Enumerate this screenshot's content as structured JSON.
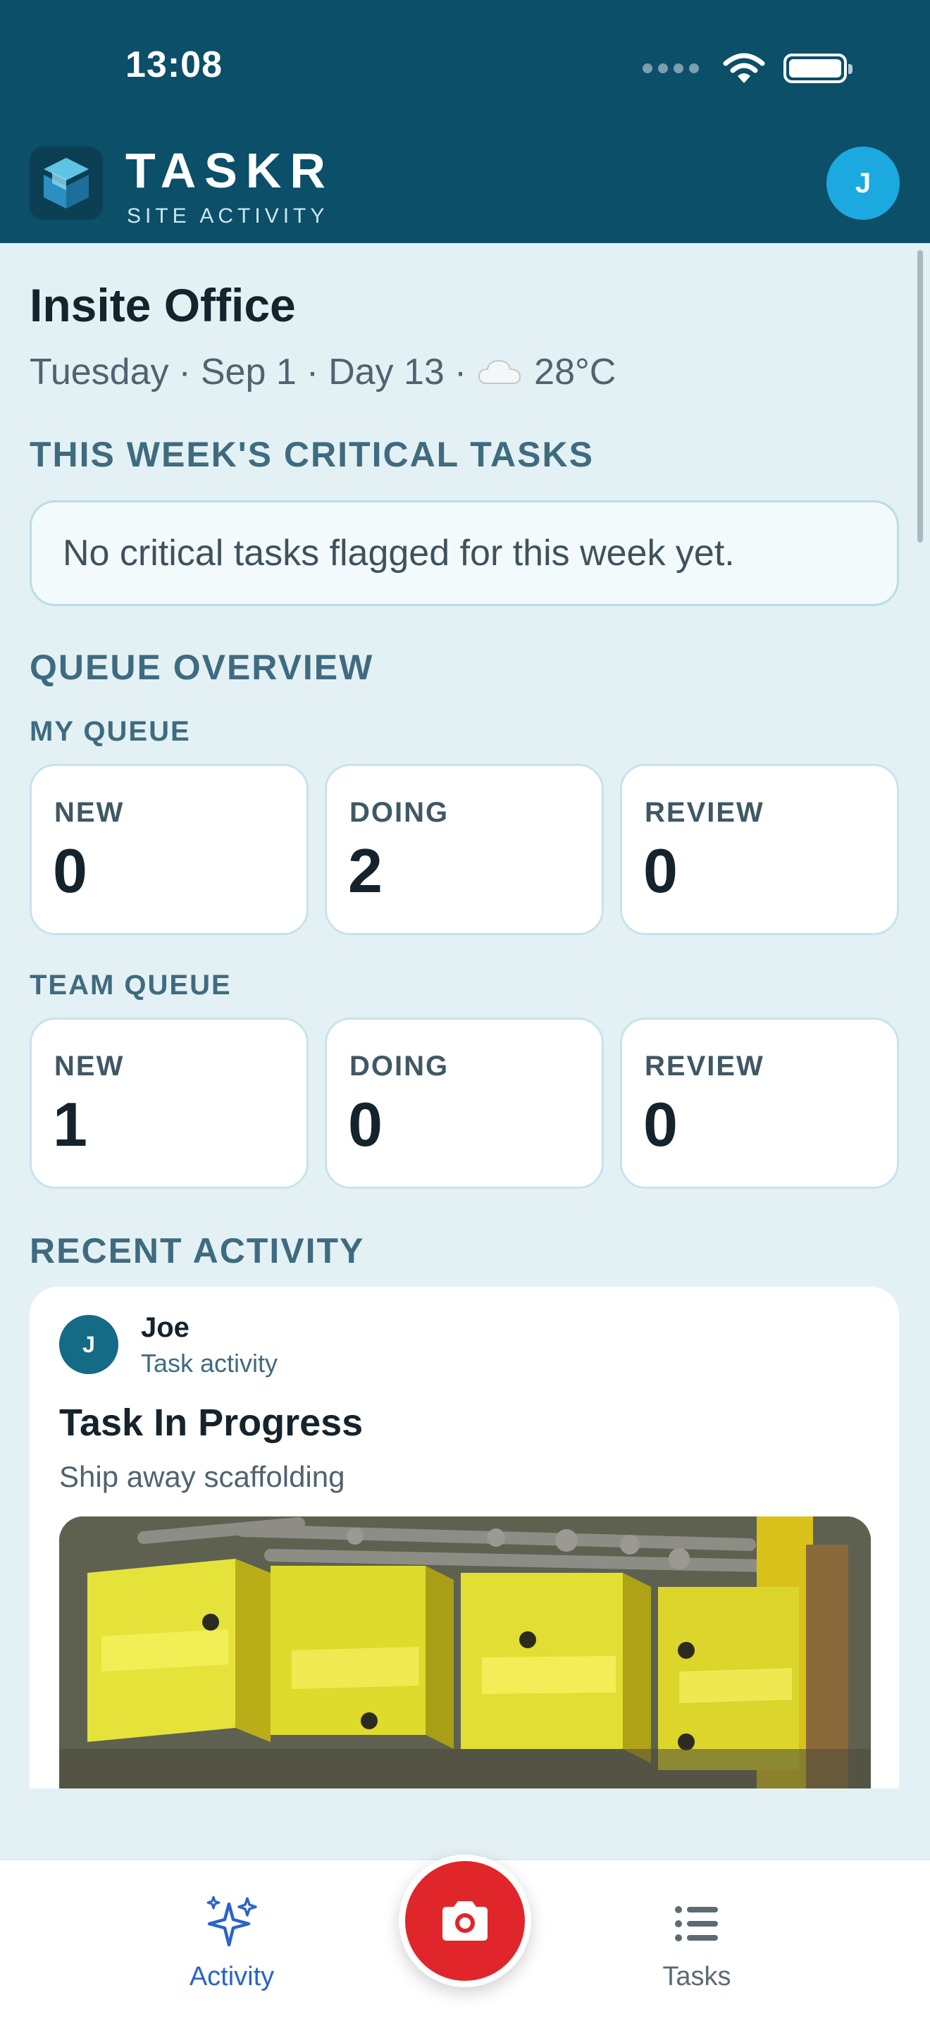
{
  "status_bar": {
    "time": "13:08"
  },
  "header": {
    "brand": "TASKR",
    "subtitle": "SITE ACTIVITY",
    "avatar_initial": "J"
  },
  "site": {
    "title": "Insite Office",
    "day": "Tuesday",
    "date": "Sep 1",
    "day_count": "Day 13",
    "separator": "·",
    "weather_icon": "cloud-icon",
    "temperature": "28°C"
  },
  "critical": {
    "heading": "THIS WEEK'S CRITICAL TASKS",
    "empty_text": "No critical tasks flagged for this week yet."
  },
  "queue": {
    "heading": "QUEUE OVERVIEW",
    "my": {
      "label": "MY QUEUE",
      "cards": [
        {
          "label": "NEW",
          "value": "0"
        },
        {
          "label": "DOING",
          "value": "2"
        },
        {
          "label": "REVIEW",
          "value": "0"
        }
      ]
    },
    "team": {
      "label": "TEAM QUEUE",
      "cards": [
        {
          "label": "NEW",
          "value": "1"
        },
        {
          "label": "DOING",
          "value": "0"
        },
        {
          "label": "REVIEW",
          "value": "0"
        }
      ]
    }
  },
  "recent": {
    "heading": "RECENT ACTIVITY",
    "items": [
      {
        "avatar_initial": "J",
        "user": "Joe",
        "kind": "Task activity",
        "title": "Task In Progress",
        "description": "Ship away scaffolding"
      }
    ]
  },
  "nav": {
    "activity_label": "Activity",
    "tasks_label": "Tasks",
    "camera_icon": "camera-icon"
  },
  "colors": {
    "header_bg": "#0b4f69",
    "page_bg": "#e3f1f5",
    "accent_blue": "#2a63c9",
    "camera_red": "#e0262a",
    "avatar_blue": "#1ba9e0"
  }
}
